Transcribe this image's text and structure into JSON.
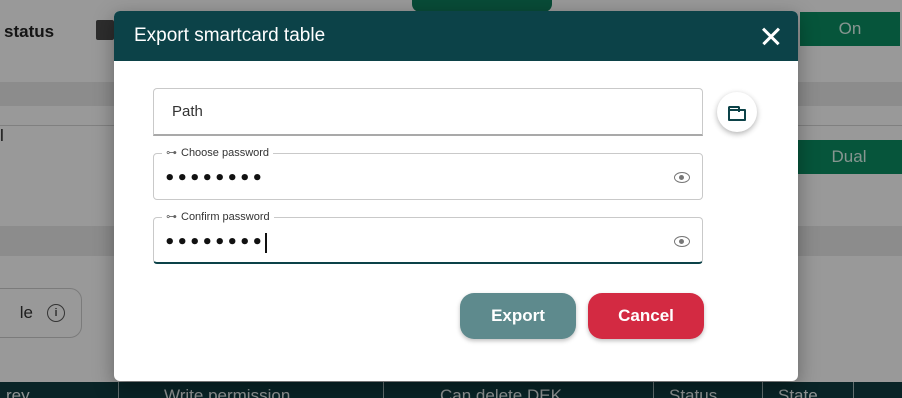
{
  "background": {
    "status_label": "status",
    "on_label": "On",
    "dual_label": "Dual",
    "left_fragment": "l",
    "row_fragment": "le",
    "table_headers": [
      "rey",
      "Write permission",
      "Can delete DEK",
      "Status",
      "State"
    ]
  },
  "dialog": {
    "title": "Export smartcard table",
    "path_placeholder": "Path",
    "choose_password_label": "Choose password",
    "choose_password_value": "••••••••",
    "confirm_password_label": "Confirm password",
    "confirm_password_value": "••••••••",
    "export_label": "Export",
    "cancel_label": "Cancel"
  },
  "colors": {
    "header": "#0c4248",
    "export_button": "#5e8a8d",
    "cancel_button": "#d32a42",
    "status_green": "#0a8a60"
  },
  "icons": {
    "close": "close-icon",
    "folder": "folder-icon",
    "key": "key-icon",
    "eye": "eye-icon",
    "info": "info-icon"
  }
}
